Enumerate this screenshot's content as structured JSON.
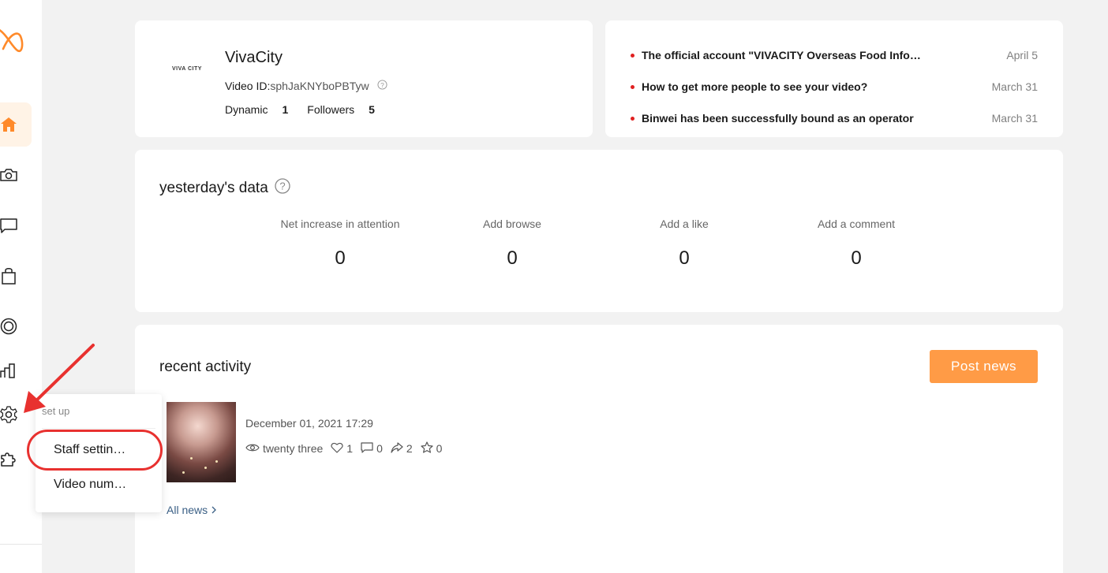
{
  "sidebar": {
    "items": [
      {
        "name": "home",
        "icon": "home-icon",
        "active": true
      },
      {
        "name": "camera",
        "icon": "camera-icon"
      },
      {
        "name": "message",
        "icon": "message-icon"
      },
      {
        "name": "shop",
        "icon": "bag-icon"
      },
      {
        "name": "live",
        "icon": "target-icon"
      },
      {
        "name": "data",
        "icon": "bar-chart-icon"
      },
      {
        "name": "settings",
        "icon": "gear-icon"
      },
      {
        "name": "plugins",
        "icon": "puzzle-icon"
      }
    ],
    "accent_color": "#ff8a2a"
  },
  "profile": {
    "logo_text": "VIVA CITY",
    "name": "VivaCity",
    "video_id_label": "Video ID:",
    "video_id_value": "sphJaKNYboPBTyw",
    "dynamic_label": "Dynamic",
    "dynamic_value": "1",
    "followers_label": "Followers",
    "followers_value": "5"
  },
  "notices": [
    {
      "title": "The official account \"VIVACITY Overseas Food Info…",
      "date": "April 5"
    },
    {
      "title": "How to get more people to see your video?",
      "date": "March 31"
    },
    {
      "title": "Binwei has been successfully bound as an operator",
      "date": "March 31"
    }
  ],
  "yesterday": {
    "title": "yesterday's data",
    "metrics": [
      {
        "label": "Net increase in attention",
        "value": "0"
      },
      {
        "label": "Add browse",
        "value": "0"
      },
      {
        "label": "Add a like",
        "value": "0"
      },
      {
        "label": "Add a comment",
        "value": "0"
      }
    ]
  },
  "activity": {
    "title": "recent activity",
    "post_button": "Post news",
    "post": {
      "date": "December 01, 2021 17:29",
      "views": "twenty three",
      "likes": "1",
      "comments": "0",
      "shares": "2",
      "favorites": "0"
    },
    "all_news": "All news"
  },
  "popup": {
    "caption": "set up",
    "items": [
      "Staff settin…",
      "Video num…"
    ]
  },
  "colors": {
    "accent": "#ff9b46",
    "notice_dot": "#e02020",
    "highlight": "#e8312f",
    "link": "#3a5f85"
  }
}
